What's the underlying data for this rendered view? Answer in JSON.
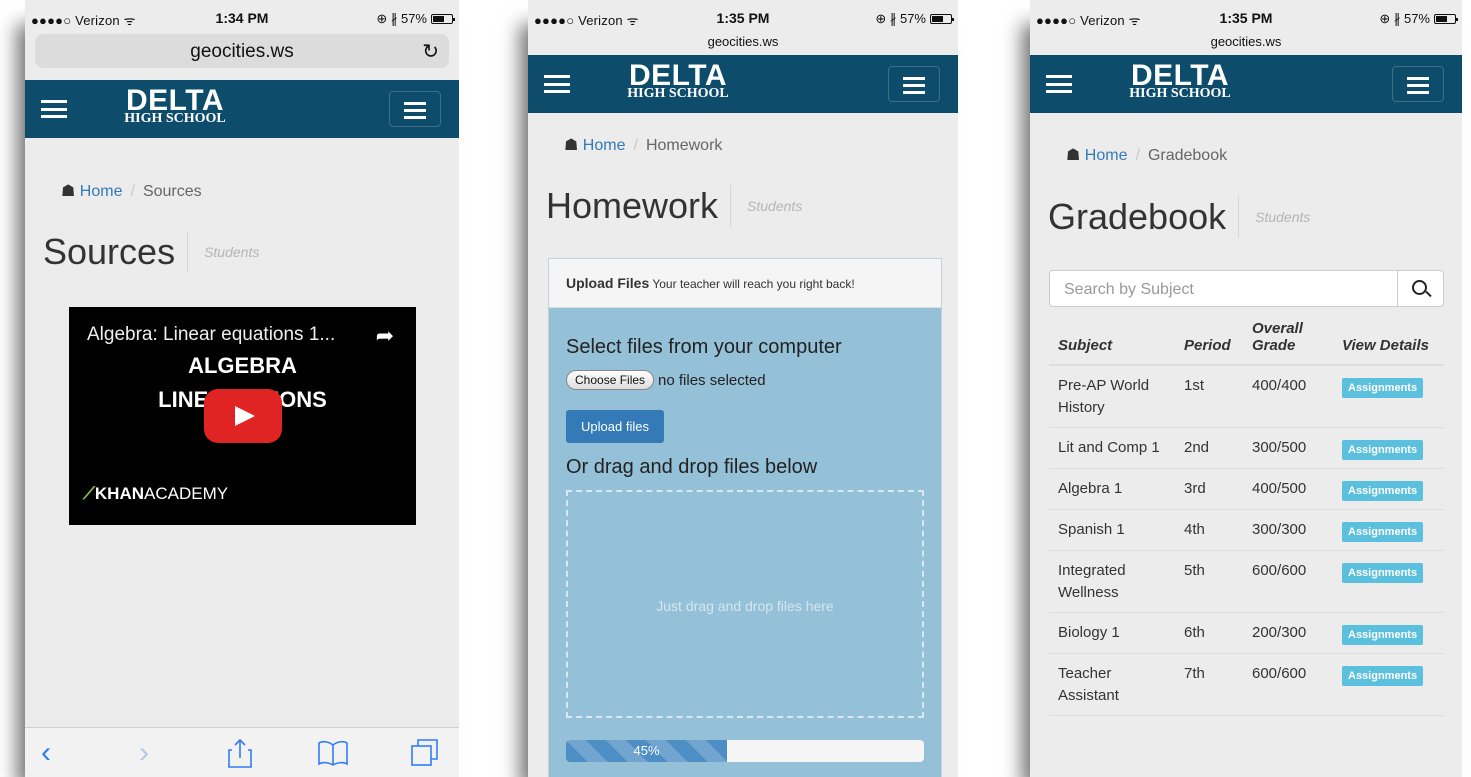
{
  "phone1": {
    "status": {
      "carrier": "●●●●○ Verizon ᯤ",
      "time": "1:34 PM",
      "right": "⊕ ∦ 57%"
    },
    "url": "geocities.ws",
    "logo": {
      "line1": "DELTA",
      "line2": "HIGH SCHOOL"
    },
    "breadcrumb": {
      "home": "Home",
      "current": "Sources"
    },
    "title": "Sources",
    "subtitle": "Students",
    "video": {
      "title": "Algebra: Linear equations 1...",
      "line1": "ALGEBRA",
      "line2": "LINEAR    ATIONS",
      "brand_bold": "KHAN",
      "brand_rest": "ACADEMY"
    }
  },
  "phone2": {
    "status": {
      "carrier": "●●●●○ Verizon ᯤ",
      "time": "1:35 PM",
      "right": "⊕ ∦ 57%"
    },
    "url": "geocities.ws",
    "logo": {
      "line1": "DELTA",
      "line2": "HIGH SCHOOL"
    },
    "breadcrumb": {
      "home": "Home",
      "current": "Homework"
    },
    "title": "Homework",
    "subtitle": "Students",
    "panel": {
      "header_bold": "Upload Files",
      "header_note": "Your teacher will reach you right back!",
      "select_heading": "Select files from your computer",
      "choose_label": "Choose Files",
      "no_files": "no files selected",
      "upload_label": "Upload files",
      "drag_heading": "Or drag and drop files below",
      "drop_text": "Just drag and drop files here",
      "progress_label": "45%",
      "progress_value": 0.45
    }
  },
  "phone3": {
    "status": {
      "carrier": "●●●●○ Verizon ᯤ",
      "time": "1:35 PM",
      "right": "⊕ ∦ 57%"
    },
    "url": "geocities.ws",
    "logo": {
      "line1": "DELTA",
      "line2": "HIGH SCHOOL"
    },
    "breadcrumb": {
      "home": "Home",
      "current": "Gradebook"
    },
    "title": "Gradebook",
    "subtitle": "Students",
    "search_placeholder": "Search by Subject",
    "columns": [
      "Subject",
      "Period",
      "Overall Grade",
      "View Details"
    ],
    "rows": [
      {
        "subject": "Pre-AP World History",
        "period": "1st",
        "grade": "400/400",
        "action": "Assignments"
      },
      {
        "subject": "Lit and Comp 1",
        "period": "2nd",
        "grade": "300/500",
        "action": "Assignments"
      },
      {
        "subject": "Algebra 1",
        "period": "3rd",
        "grade": "400/500",
        "action": "Assignments"
      },
      {
        "subject": "Spanish 1",
        "period": "4th",
        "grade": "300/300",
        "action": "Assignments"
      },
      {
        "subject": "Integrated Wellness",
        "period": "5th",
        "grade": "600/600",
        "action": "Assignments"
      },
      {
        "subject": "Biology 1",
        "period": "6th",
        "grade": "200/300",
        "action": "Assignments"
      },
      {
        "subject": "Teacher Assistant",
        "period": "7th",
        "grade": "600/600",
        "action": "Assignments"
      }
    ]
  },
  "colors": {
    "navbar": "#0d4c6b",
    "link": "#337ab7",
    "badge": "#5bc0de",
    "panel_body": "#94c1d7"
  },
  "icons": [
    "hamburger-icon",
    "menu-toggle-icon",
    "home-icon",
    "reload-icon",
    "share-icon",
    "play-icon",
    "search-icon",
    "back-icon",
    "forward-icon",
    "share-sheet-icon",
    "bookmarks-icon",
    "tabs-icon"
  ]
}
